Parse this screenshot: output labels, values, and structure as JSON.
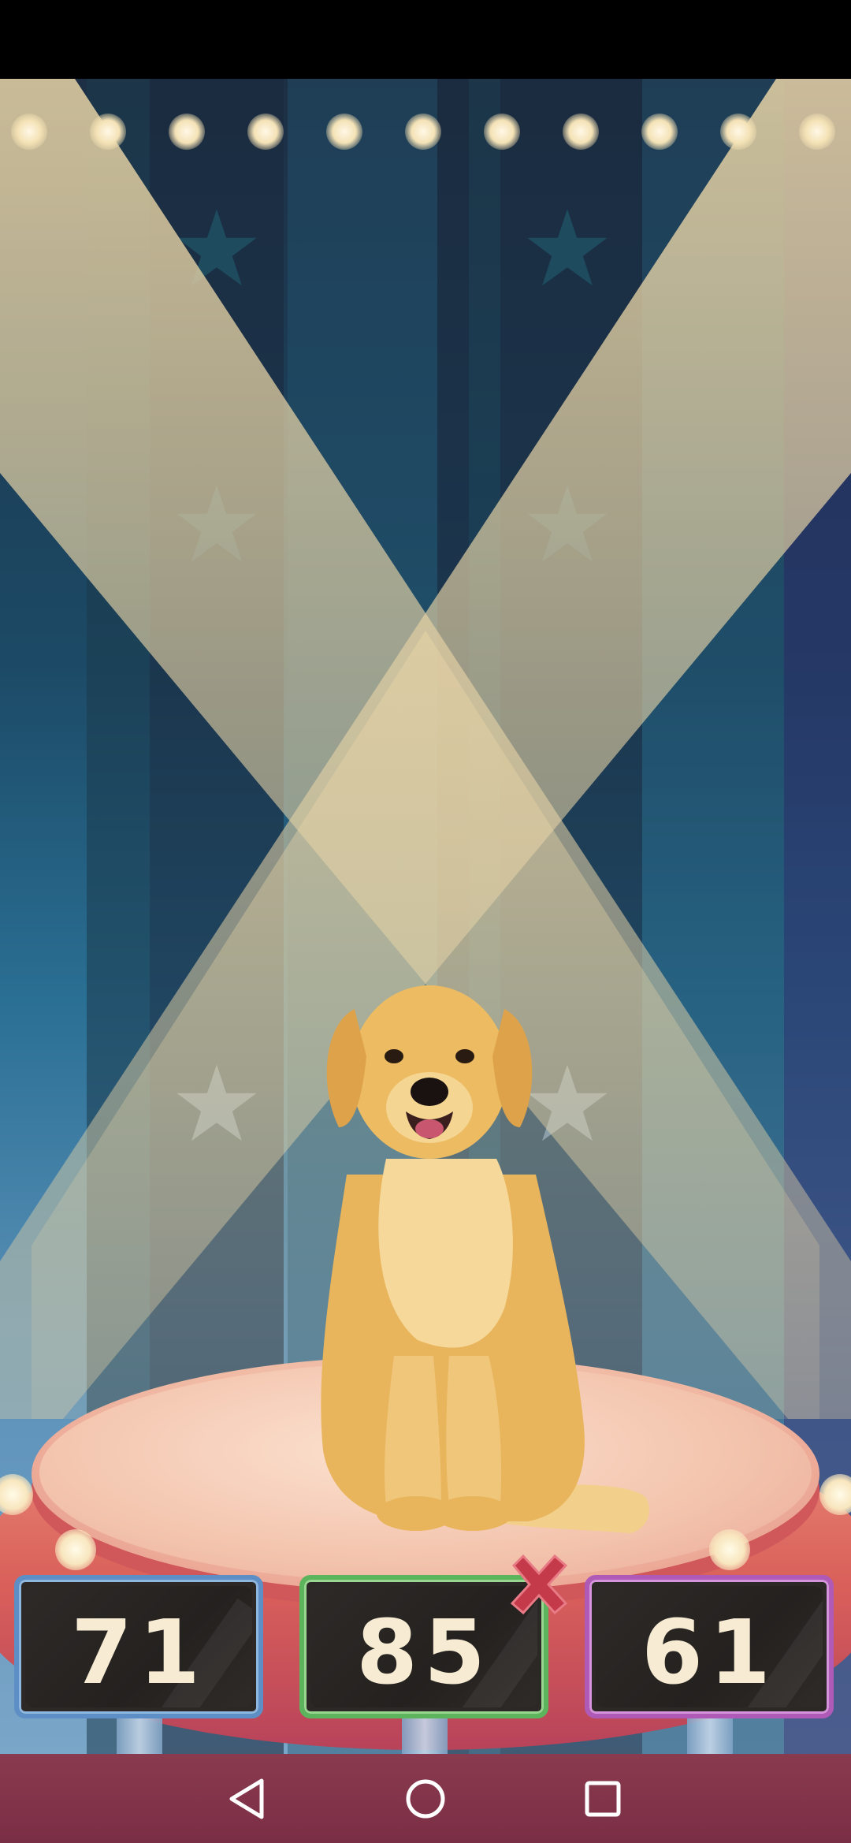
{
  "scores": {
    "judge_1": "71",
    "judge_2": "85",
    "judge_3": "61"
  },
  "colors": {
    "judge_1_border": "#5d8fc6",
    "judge_2_border": "#5cb55c",
    "judge_3_border": "#b05ab8",
    "reject_mark": "#c43a4a",
    "score_text": "#f7ecd3"
  },
  "icons": {
    "reject": "cross-icon",
    "nav_back": "back-triangle-icon",
    "nav_home": "home-circle-icon",
    "nav_recents": "recents-square-icon"
  }
}
